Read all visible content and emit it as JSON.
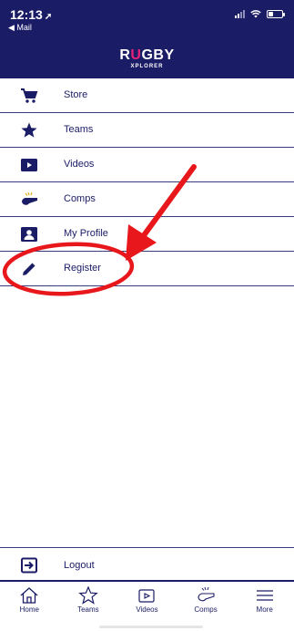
{
  "status_bar": {
    "time": "12:13",
    "location_arrow": "➚",
    "back_label": "◀ Mail"
  },
  "header": {
    "logo_main_prefix": "R",
    "logo_main_accent": "U",
    "logo_main_suffix": "GBY",
    "logo_sub": "XPLORER"
  },
  "menu": {
    "items": [
      {
        "label": "Store",
        "icon": "cart-icon"
      },
      {
        "label": "Teams",
        "icon": "star-icon"
      },
      {
        "label": "Videos",
        "icon": "video-icon"
      },
      {
        "label": "Comps",
        "icon": "whistle-icon"
      },
      {
        "label": "My Profile",
        "icon": "profile-icon"
      },
      {
        "label": "Register",
        "icon": "pencil-icon"
      }
    ],
    "logout_label": "Logout"
  },
  "tabbar": {
    "tabs": [
      {
        "label": "Home",
        "icon": "home-icon"
      },
      {
        "label": "Teams",
        "icon": "star-outline-icon"
      },
      {
        "label": "Videos",
        "icon": "play-icon"
      },
      {
        "label": "Comps",
        "icon": "whistle-icon"
      },
      {
        "label": "More",
        "icon": "hamburger-icon"
      }
    ]
  },
  "colors": {
    "brand_navy": "#1b1c66",
    "logo_accent": "#e6217a",
    "annotation_red": "#e8171c"
  }
}
